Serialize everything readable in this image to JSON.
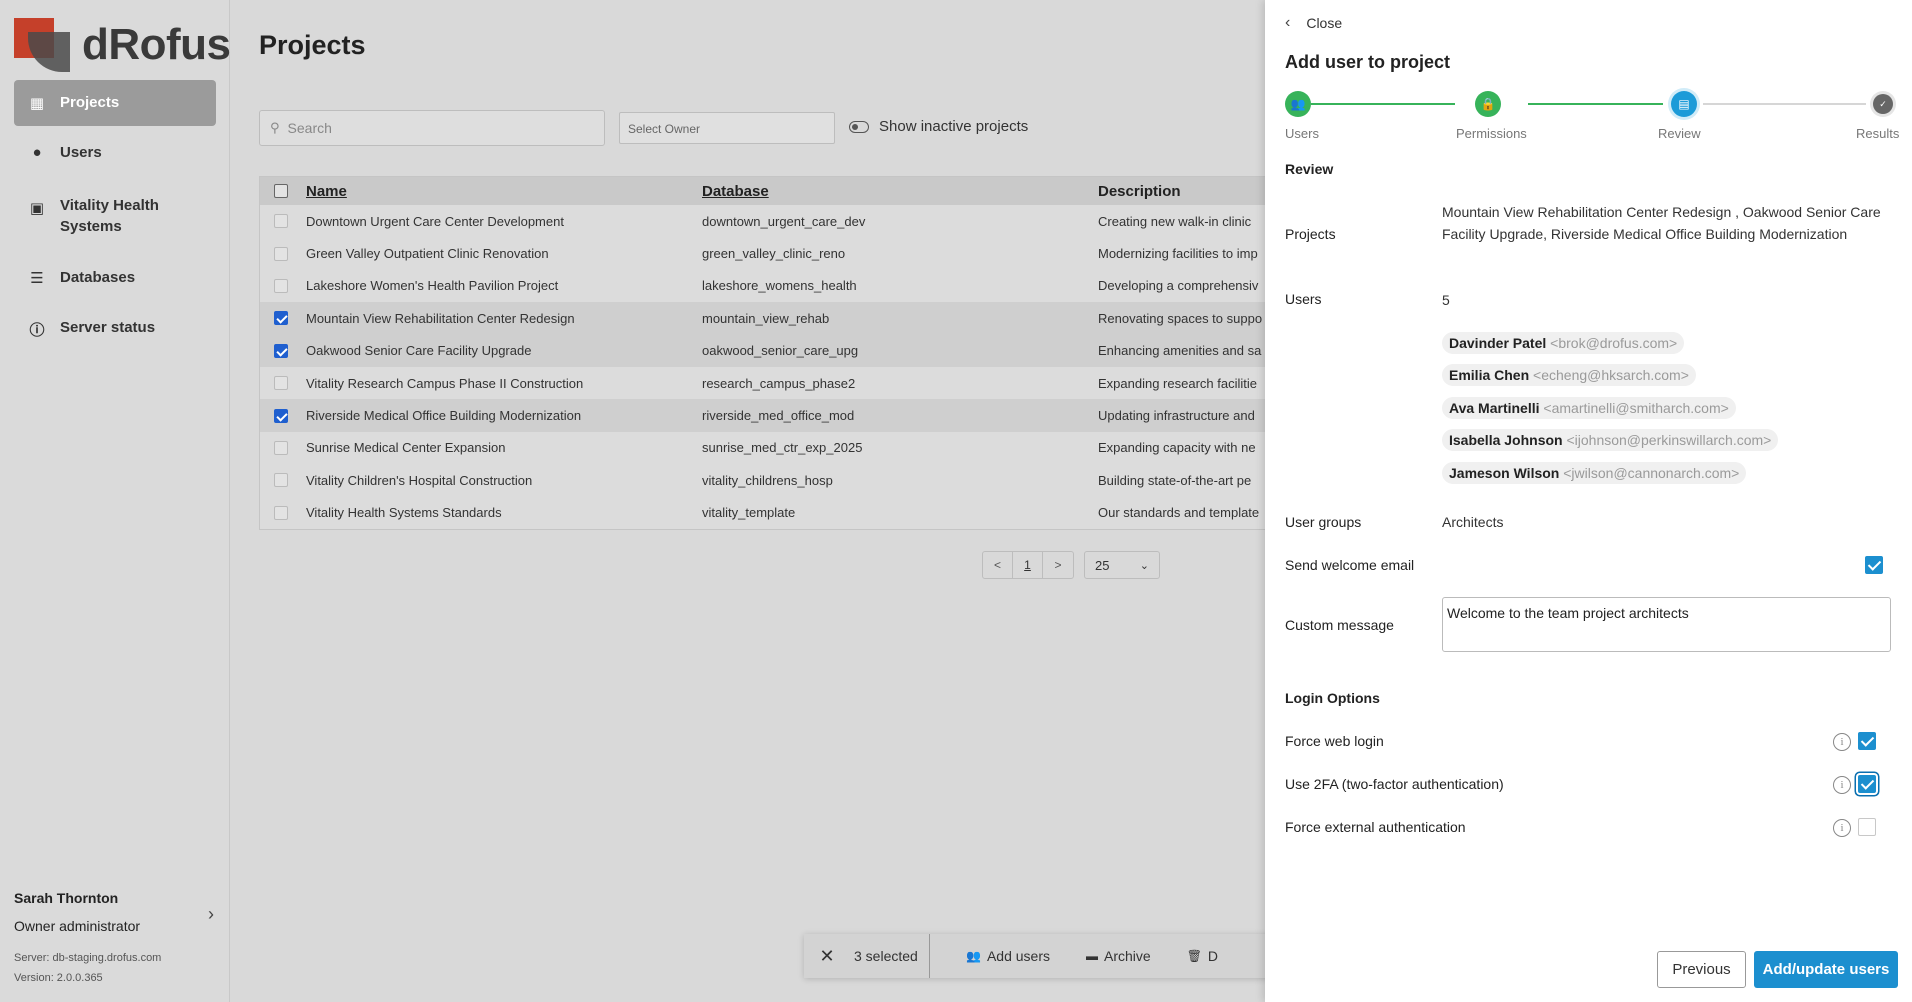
{
  "brand": {
    "logo_text": "dRofus"
  },
  "sidebar": {
    "items": [
      {
        "label": "Projects",
        "icon": "building-icon"
      },
      {
        "label": "Users",
        "icon": "user-icon"
      },
      {
        "label": "Vitality Health Systems",
        "icon": "briefcase-icon"
      },
      {
        "label": "Databases",
        "icon": "database-icon"
      },
      {
        "label": "Server status",
        "icon": "info-icon"
      }
    ],
    "user": {
      "name": "Sarah Thornton",
      "role": "Owner administrator",
      "server": "Server: db-staging.drofus.com",
      "version": "Version: 2.0.0.365"
    }
  },
  "main": {
    "title": "Projects",
    "search_placeholder": "Search",
    "owner_placeholder": "Select Owner",
    "inactive_label": "Show inactive projects",
    "columns": [
      "Name",
      "Database",
      "Description"
    ],
    "rows": [
      {
        "name": "Downtown Urgent Care Center Development",
        "db": "downtown_urgent_care_dev",
        "desc": "Creating new walk-in clinic",
        "checked": false
      },
      {
        "name": "Green Valley Outpatient Clinic Renovation",
        "db": "green_valley_clinic_reno",
        "desc": "Modernizing facilities to imp",
        "checked": false
      },
      {
        "name": "Lakeshore Women's Health Pavilion Project",
        "db": "lakeshore_womens_health",
        "desc": "Developing a comprehensiv",
        "checked": false
      },
      {
        "name": "Mountain View Rehabilitation Center Redesign",
        "db": "mountain_view_rehab",
        "desc": "Renovating spaces to suppo",
        "checked": true
      },
      {
        "name": "Oakwood Senior Care Facility Upgrade",
        "db": "oakwood_senior_care_upg",
        "desc": "Enhancing amenities and sa",
        "checked": true
      },
      {
        "name": "Vitality Research Campus Phase II Construction",
        "db": "research_campus_phase2",
        "desc": "Expanding research facilitie",
        "checked": false
      },
      {
        "name": "Riverside Medical Office Building Modernization",
        "db": "riverside_med_office_mod",
        "desc": "Updating infrastructure and",
        "checked": true
      },
      {
        "name": "Sunrise Medical Center Expansion",
        "db": "sunrise_med_ctr_exp_2025",
        "desc": "Expanding capacity with ne",
        "checked": false
      },
      {
        "name": "Vitality Children's Hospital Construction",
        "db": "vitality_childrens_hosp",
        "desc": "Building state-of-the-art pe",
        "checked": false
      },
      {
        "name": "Vitality Health Systems Standards",
        "db": "vitality_template",
        "desc": "Our standards and template",
        "checked": false
      }
    ],
    "pager": {
      "prev": "<",
      "page": "1",
      "next": ">",
      "per_page": "25"
    },
    "actionbar": {
      "close": "✕",
      "selected": "3 selected",
      "add_users": "Add users",
      "archive": "Archive",
      "delete": "D"
    }
  },
  "panel": {
    "close_label": "Close",
    "title": "Add user to project",
    "steps": [
      {
        "label": "Users",
        "state": "done",
        "icon": "users-icon"
      },
      {
        "label": "Permissions",
        "state": "done",
        "icon": "lock-icon"
      },
      {
        "label": "Review",
        "state": "current",
        "icon": "clipboard-icon"
      },
      {
        "label": "Results",
        "state": "pending",
        "icon": "check-icon"
      }
    ],
    "review_heading": "Review",
    "projects_label": "Projects",
    "projects_value": "Mountain View Rehabilitation Center Redesign , Oakwood Senior Care Facility Upgrade, Riverside Medical Office Building Modernization",
    "users_label": "Users",
    "users_count": "5",
    "users": [
      {
        "name": "Davinder Patel",
        "email": "<brok@drofus.com>"
      },
      {
        "name": "Emilia Chen",
        "email": "<echeng@hksarch.com>"
      },
      {
        "name": "Ava Martinelli",
        "email": "<amartinelli@smitharch.com>"
      },
      {
        "name": "Isabella Johnson",
        "email": "<ijohnson@perkinswillarch.com>"
      },
      {
        "name": "Jameson Wilson",
        "email": "<jwilson@cannonarch.com>"
      }
    ],
    "user_groups_label": "User groups",
    "user_groups_value": "Architects",
    "welcome_label": "Send welcome email",
    "welcome_checked": true,
    "message_label": "Custom message",
    "message_value": "Welcome to the team project architects",
    "login_heading": "Login Options",
    "login_options": [
      {
        "label": "Force web login",
        "checked": true
      },
      {
        "label": "Use 2FA (two-factor authentication)",
        "checked": true
      },
      {
        "label": "Force external authentication",
        "checked": false
      }
    ],
    "info_glyph": "i",
    "previous_label": "Previous",
    "submit_label": "Add/update users",
    "colors": {
      "accent": "#1c8fcf",
      "done": "#37b35a",
      "brand": "#c5402a"
    }
  }
}
